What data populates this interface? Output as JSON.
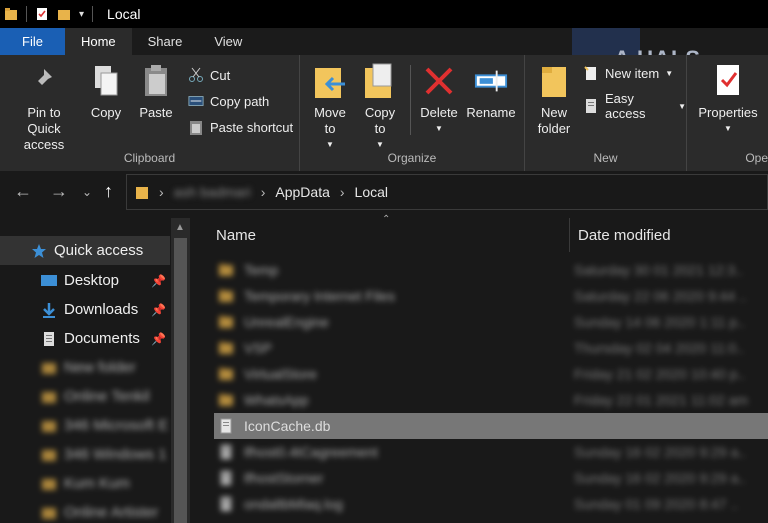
{
  "window": {
    "title": "Local"
  },
  "tabs": [
    "File",
    "Home",
    "Share",
    "View"
  ],
  "watermark": "A  UALS",
  "ribbon": {
    "clipboard": {
      "label": "Clipboard",
      "pin": "Pin to Quick access",
      "copy": "Copy",
      "paste": "Paste",
      "cut": "Cut",
      "copy_path": "Copy path",
      "paste_shortcut": "Paste shortcut"
    },
    "organize": {
      "label": "Organize",
      "move_to": "Move to",
      "copy_to": "Copy to",
      "delete": "Delete",
      "rename": "Rename"
    },
    "new": {
      "label": "New",
      "new_folder": "New folder",
      "new_item": "New item",
      "easy_access": "Easy access"
    },
    "open": {
      "label": "Ope",
      "properties": "Properties"
    }
  },
  "address": {
    "user": "ash badmari",
    "seg1": "AppData",
    "seg2": "Local"
  },
  "nav": {
    "quick_access": "Quick access",
    "desktop": "Desktop",
    "downloads": "Downloads",
    "documents": "Documents",
    "blurred": [
      "New folder",
      "Online Tenkil",
      "346 Microsoft E",
      "346 Windows 1",
      "Kum Kum",
      "Online Artister"
    ]
  },
  "columns": {
    "name": "Name",
    "date": "Date modified"
  },
  "files": [
    {
      "name": "Temp",
      "date": "Saturday 30 01 2021 12:3..",
      "type": "folder",
      "blurred": true
    },
    {
      "name": "Temporary Internet Files",
      "date": "Saturday 22 06 2020 9:44 ..",
      "type": "folder",
      "blurred": true
    },
    {
      "name": "UnrealEngine",
      "date": "Sunday 14 06 2020 1:11 p..",
      "type": "folder",
      "blurred": true
    },
    {
      "name": "VSP",
      "date": "Thursday 02 04 2020 11:0..",
      "type": "folder",
      "blurred": true
    },
    {
      "name": "VirtualStore",
      "date": "Friday 21 02 2020 10:40 p..",
      "type": "folder",
      "blurred": true
    },
    {
      "name": "WhatsApp",
      "date": "Friday 22 01 2021 11:02 am",
      "type": "folder",
      "blurred": true
    },
    {
      "name": "IconCache.db",
      "date": "",
      "type": "file",
      "blurred": false,
      "selected": true
    },
    {
      "name": "lfhost0.4tCagreement",
      "date": "Sunday 16 02 2020 9:29 a..",
      "type": "file",
      "blurred": true
    },
    {
      "name": "lfhostStorner",
      "date": "Sunday 16 02 2020 9:29 a..",
      "type": "file",
      "blurred": true
    },
    {
      "name": "ondaltbMlaq.log",
      "date": "Sunday 01 09 2020 8:47 ..",
      "type": "file",
      "blurred": true
    }
  ]
}
